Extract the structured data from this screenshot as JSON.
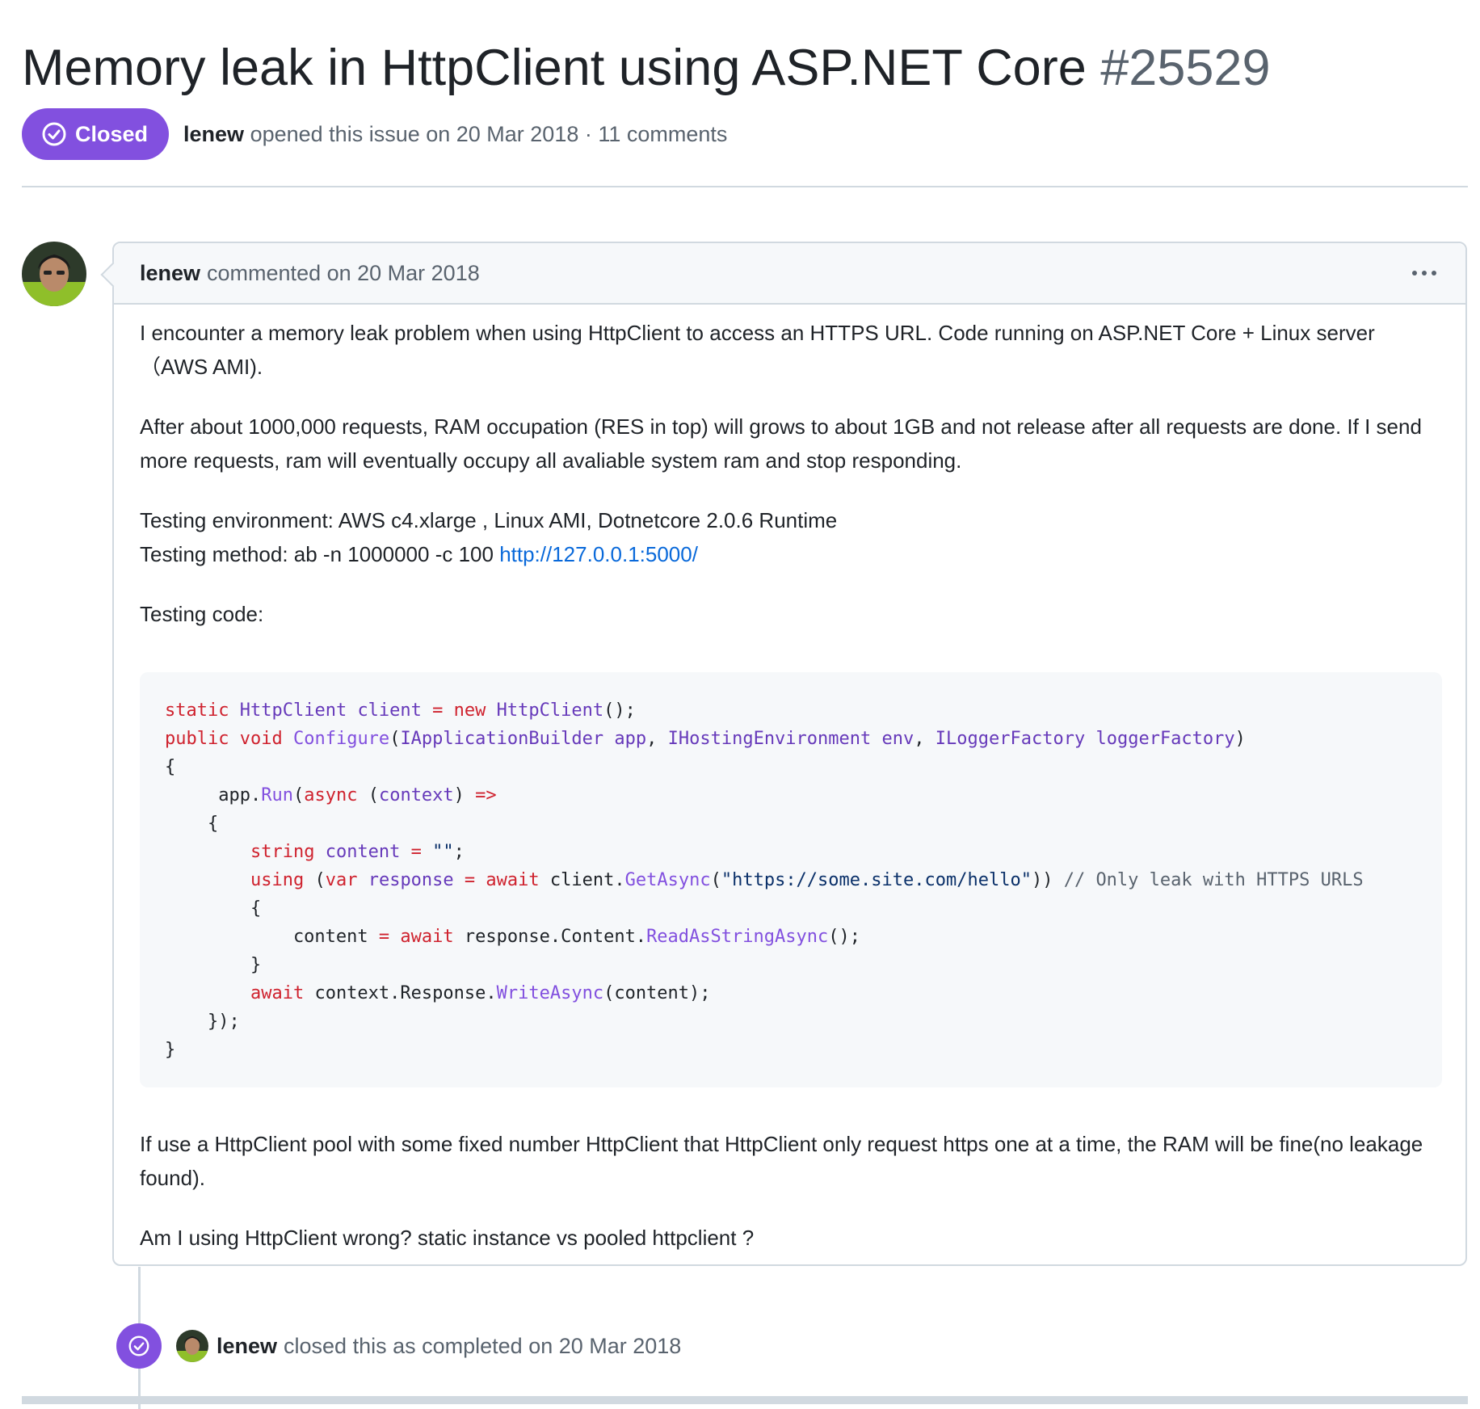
{
  "issue": {
    "title": "Memory leak in HttpClient using ASP.NET Core",
    "number": "#25529",
    "state_label": "Closed",
    "author": "lenew",
    "opened_text": "opened this issue on 20 Mar 2018 · 11 comments"
  },
  "comment": {
    "author": "lenew",
    "header_text": "commented on 20 Mar 2018",
    "paragraph1": "I encounter a memory leak problem when using HttpClient to access an HTTPS URL. Code running on ASP.NET Core + Linux server （AWS AMI).",
    "paragraph2": "After about 1000,000 requests, RAM occupation (RES in top) will grows to about 1GB and not release after all requests are done. If I send more requests, ram will eventually occupy all avaliable system ram and stop responding.",
    "env_line": "Testing environment: AWS c4.xlarge , Linux AMI, Dotnetcore 2.0.6 Runtime",
    "method_prefix": "Testing method: ab -n 1000000 -c 100 ",
    "method_link": "http://127.0.0.1:5000/",
    "code_label": "Testing code:",
    "paragraph5": "If use a HttpClient pool with some fixed number HttpClient that HttpClient only request https one at a time, the RAM will be fine(no leakage found).",
    "paragraph6": "Am I using HttpClient wrong? static instance vs pooled httpclient ?"
  },
  "code_lines": [
    "static HttpClient client = new HttpClient();",
    "public void Configure(IApplicationBuilder app, IHostingEnvironment env, ILoggerFactory loggerFactory)",
    "{",
    "     app.Run(async (context) =>",
    "    {",
    "        string content = \"\";",
    "        using (var response = await client.GetAsync(\"https://some.site.com/hello\")) // Only leak with HTTPS URLS",
    "        {",
    "            content = await response.Content.ReadAsStringAsync();",
    "        }",
    "        await context.Response.WriteAsync(content);",
    "    });",
    "}"
  ],
  "event": {
    "actor": "lenew",
    "text": "closed this as completed on 20 Mar 2018"
  },
  "colors": {
    "closed_purple": "#8250df",
    "link_blue": "#0969da",
    "keyword_red": "#cf222e",
    "border": "#d1d9e0"
  },
  "icons": [
    "check-circle-icon",
    "kebab-menu-icon",
    "avatar-image"
  ]
}
